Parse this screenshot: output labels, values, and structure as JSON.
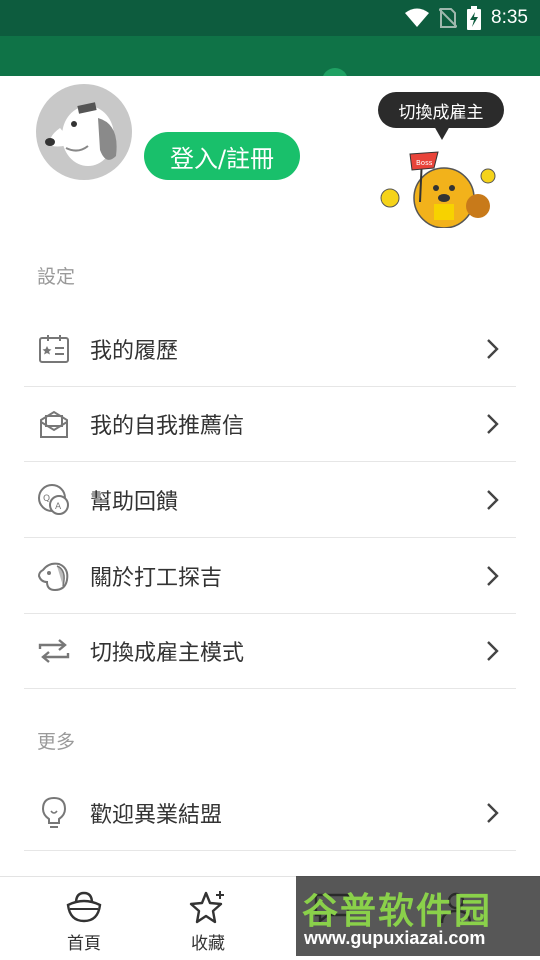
{
  "status_bar": {
    "time": "8:35",
    "icons": [
      "wifi-icon",
      "no-sim-icon",
      "battery-charging-icon"
    ]
  },
  "header": {
    "login_label": "登入/註冊",
    "switch_bubble": "切換成雇主",
    "mascot_flag": "Boss"
  },
  "sections": [
    {
      "title": "設定",
      "items": [
        {
          "label": "我的履歷",
          "icon": "resume-icon"
        },
        {
          "label": "我的自我推薦信",
          "icon": "envelope-icon"
        },
        {
          "label": "幫助回饋",
          "icon": "qa-icon"
        },
        {
          "label": "關於打工探吉",
          "icon": "dog-icon"
        },
        {
          "label": "切換成雇主模式",
          "icon": "switch-icon"
        }
      ]
    },
    {
      "title": "更多",
      "items": [
        {
          "label": "歡迎異業結盟",
          "icon": "lightbulb-icon"
        }
      ]
    }
  ],
  "bottom_nav": [
    {
      "label": "首頁",
      "icon": "home-icon"
    },
    {
      "label": "收藏",
      "icon": "star-icon"
    },
    {
      "label": "",
      "icon": "chat-icon"
    },
    {
      "label": "",
      "icon": "profile-icon"
    }
  ],
  "watermark": {
    "top": "谷普软件园",
    "bottom": "www.gupuxiazai.com"
  },
  "colors": {
    "status_bar": "#0d5c3e",
    "band": "#0f7347",
    "accent": "#19c06b"
  }
}
